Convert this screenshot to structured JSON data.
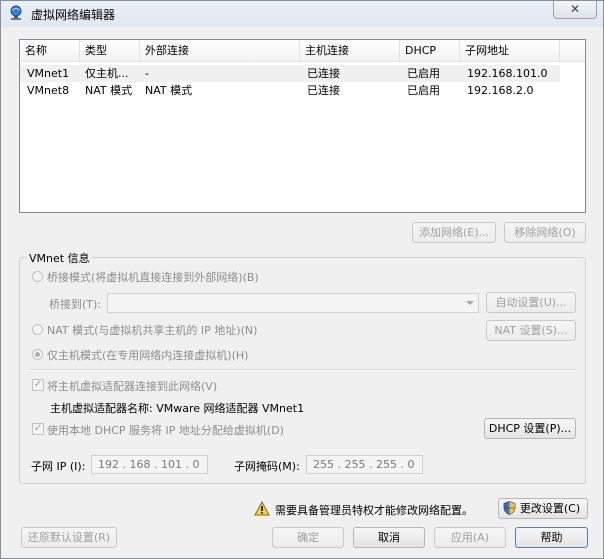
{
  "window": {
    "title": "虚拟网络编辑器",
    "close_glyph": "✕"
  },
  "table": {
    "columns": [
      "名称",
      "类型",
      "外部连接",
      "主机连接",
      "DHCP",
      "子网地址"
    ],
    "rows": [
      {
        "name": "VMnet1",
        "type": "仅主机...",
        "external": "-",
        "host": "已连接",
        "dhcp": "已启用",
        "subnet": "192.168.101.0"
      },
      {
        "name": "VMnet8",
        "type": "NAT 模式",
        "external": "NAT 模式",
        "host": "已连接",
        "dhcp": "已启用",
        "subnet": "192.168.2.0"
      }
    ]
  },
  "list_buttons": {
    "add": "添加网络(E)...",
    "remove": "移除网络(O)"
  },
  "vmnet_info": {
    "label": "VMnet 信息",
    "bridged_radio": "桥接模式(将虚拟机直接连接到外部网络)(B)",
    "bridge_to_label": "桥接到(T):",
    "bridge_to_value": "",
    "auto_settings": "自动设置(U)...",
    "nat_radio": "NAT 模式(与虚拟机共享主机的 IP 地址)(N)",
    "nat_settings": "NAT 设置(S)...",
    "hostonly_radio": "仅主机模式(在专用网络内连接虚拟机)(H)",
    "connect_adapter_check": "将主机虚拟适配器连接到此网络(V)",
    "adapter_name": "主机虚拟适配器名称: VMware 网络适配器 VMnet1",
    "dhcp_check": "使用本地 DHCP 服务将 IP 地址分配给虚拟机(D)",
    "dhcp_settings": "DHCP 设置(P)...",
    "subnet_ip_label": "子网 IP (I):",
    "subnet_ip": "192 . 168 . 101 . 0",
    "subnet_mask_label": "子网掩码(M):",
    "subnet_mask": "255 . 255 . 255 . 0"
  },
  "footer": {
    "warning": "需要具备管理员特权才能修改网络配置。",
    "change_settings": "更改设置(C)",
    "restore_defaults": "还原默认设置(R)",
    "ok": "确定",
    "cancel": "取消",
    "apply": "应用(A)",
    "help": "帮助"
  },
  "colors": {
    "warning_yellow": "#f7d23a",
    "shield_blue": "#3b73c0",
    "shield_yellow": "#f2c531"
  }
}
